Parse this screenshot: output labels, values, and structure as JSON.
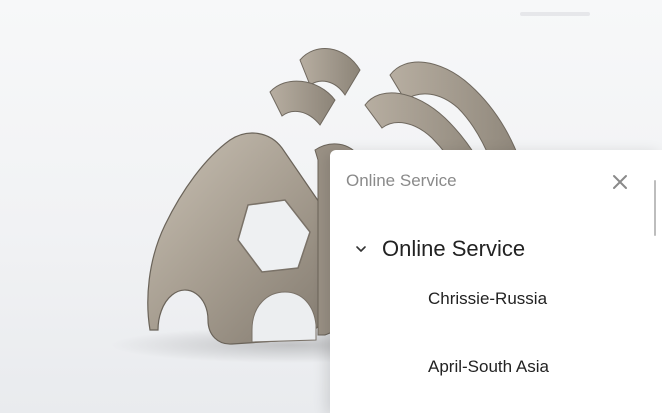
{
  "panel": {
    "title": "Online Service",
    "close_icon": "close-icon",
    "group": {
      "label": "Online Service",
      "icon": "chevron-down-icon",
      "expanded": true,
      "agents": [
        {
          "label": "Chrissie-Russia"
        },
        {
          "label": "April-South Asia"
        }
      ]
    }
  },
  "colors": {
    "panel_background": "#ffffff",
    "title_text": "#8a8a8a",
    "body_text": "#222222",
    "metal": "#a39a8d"
  }
}
